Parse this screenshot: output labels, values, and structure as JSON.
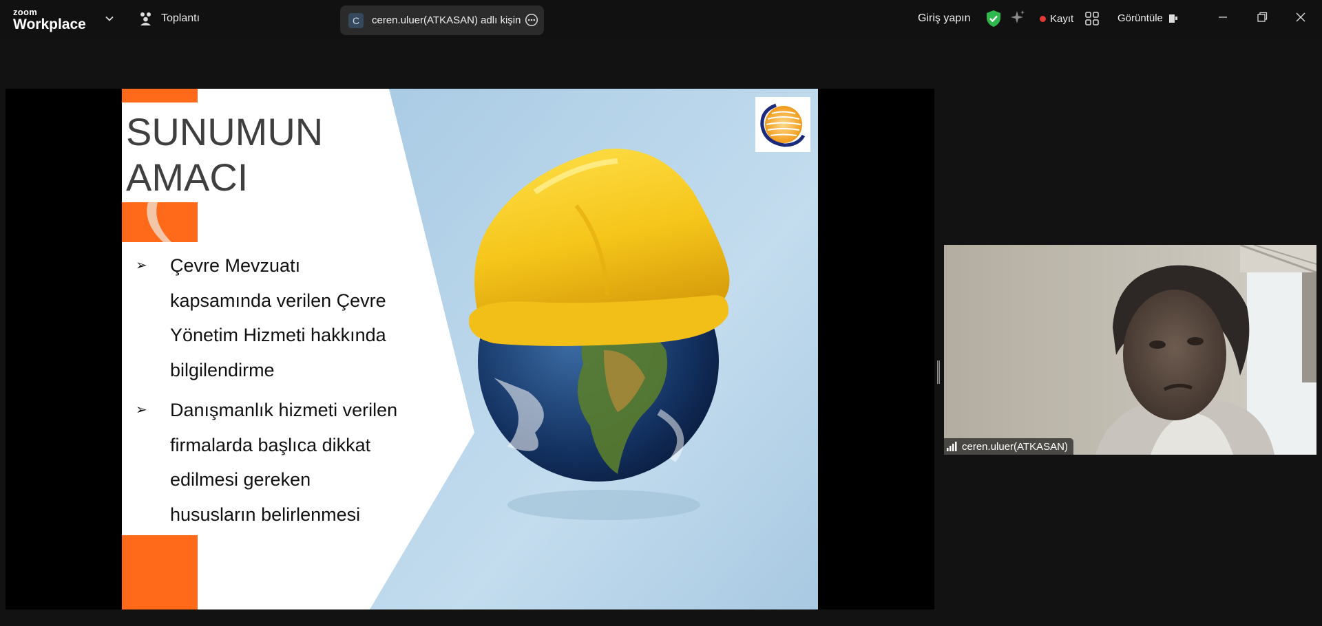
{
  "app": {
    "logo_small": "zoom",
    "logo_big": "Workplace",
    "meeting_label": "Toplantı",
    "share_pill_avatar": "C",
    "share_pill_text": "ceren.uluer(ATKASAN) adlı kişinin",
    "login_label": "Giriş yapın",
    "record_label": "Kayıt",
    "view_label": "Görüntüle"
  },
  "icons": {
    "chevron": "chevron-down-icon",
    "meeting": "participants-icon",
    "more": "more-options-icon",
    "shield": "shield-check-icon",
    "sparkle": "ai-sparkle-icon",
    "record": "record-dot-icon",
    "grid": "apps-grid-icon",
    "view": "view-layout-icon",
    "minimize": "minimize-icon",
    "restore": "restore-icon",
    "close": "close-icon"
  },
  "colors": {
    "topbar_bg": "#111111",
    "shield_green": "#2fb84d",
    "record_red": "#e53935",
    "slide_orange": "#ff6a1a",
    "slide_blue": "#b7d2e6",
    "helmet_yellow": "#f5c51a"
  },
  "slide": {
    "title_line1": "SUNUMUN",
    "title_line2": "AMACI",
    "bullets": [
      {
        "marker": "➢",
        "lines": [
          "Çevre Mevzuatı",
          "kapsamında verilen Çevre",
          "Yönetim Hizmeti hakkında",
          "bilgilendirme"
        ]
      },
      {
        "marker": "➢",
        "lines": [
          "Danışmanlık hizmeti verilen",
          "firmalarda başlıca dikkat",
          "edilmesi gereken",
          "hususların belirlenmesi"
        ]
      }
    ]
  },
  "participant": {
    "name": "ceren.uluer(ATKASAN)"
  }
}
